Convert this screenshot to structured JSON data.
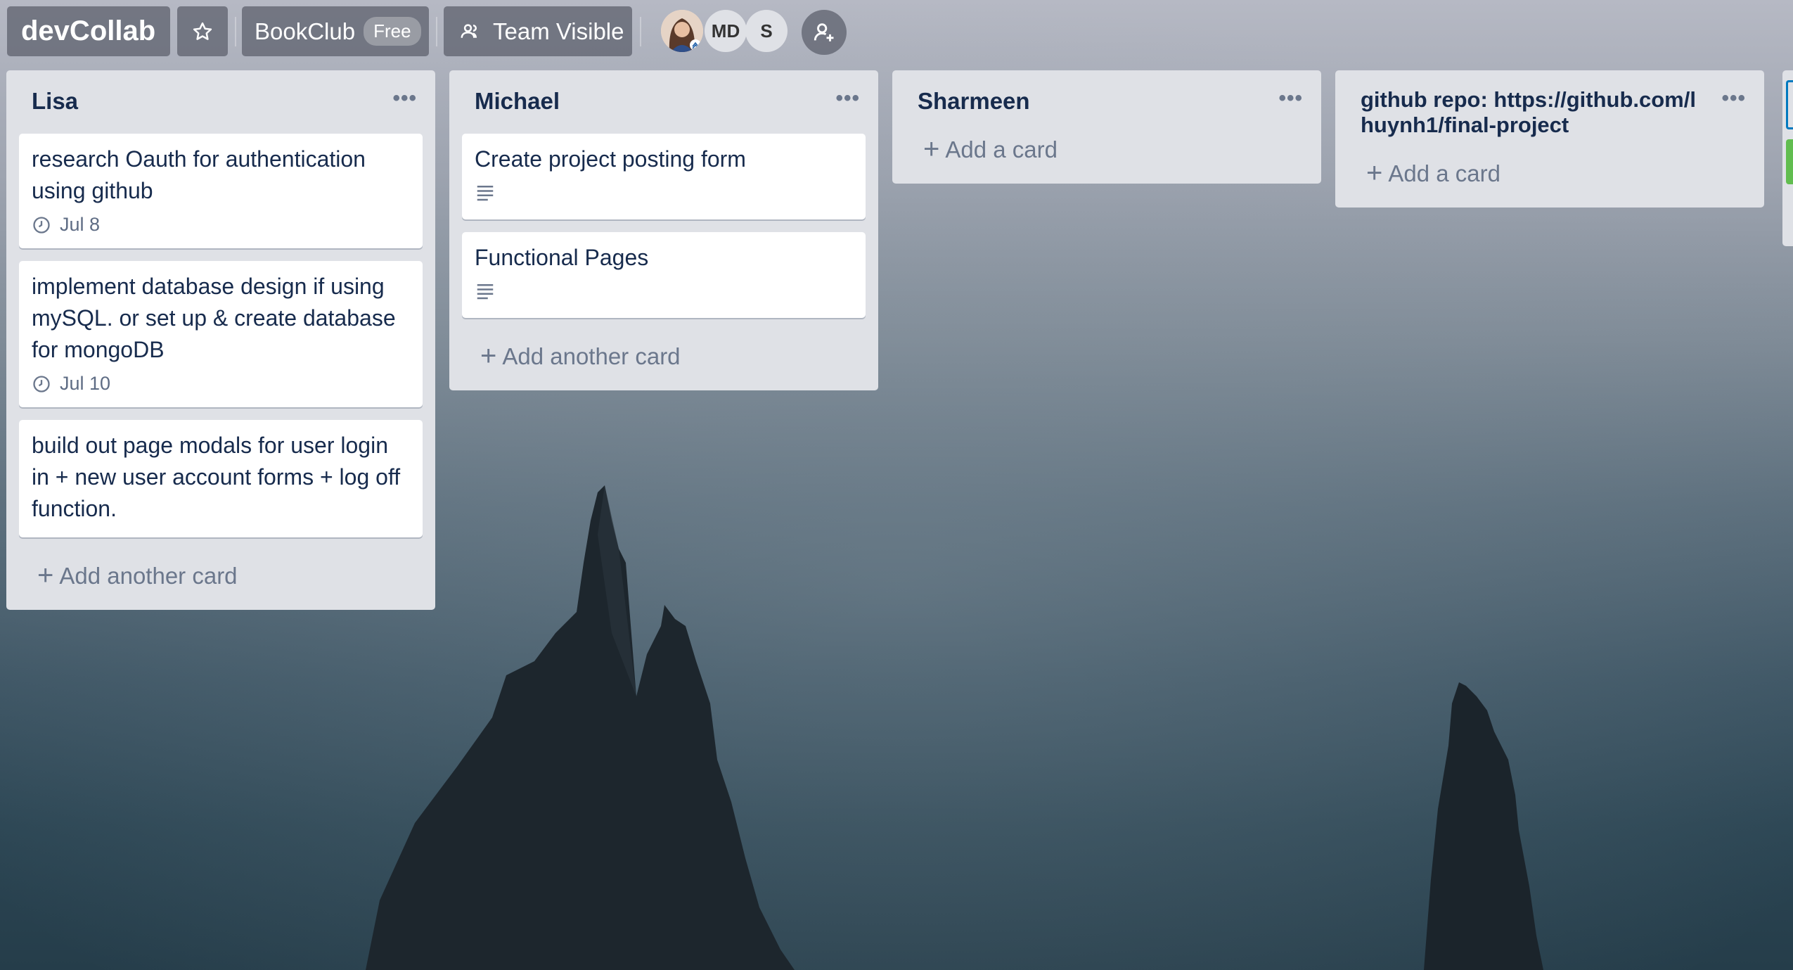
{
  "board": {
    "title": "devCollab",
    "org_name": "BookClub",
    "org_badge": "Free",
    "visibility": "Team Visible",
    "members": [
      {
        "initials": ""
      },
      {
        "initials": "MD"
      },
      {
        "initials": "S"
      }
    ]
  },
  "lists": [
    {
      "name": "Lisa",
      "cards": [
        {
          "title": "research Oauth for authentication using github",
          "due": "Jul 8"
        },
        {
          "title": "implement database design if using mySQL. or set up & create database for mongoDB",
          "due": "Jul 10"
        },
        {
          "title": "build out page modals for user login in + new user account forms + log off function."
        }
      ],
      "add_label": "Add another card"
    },
    {
      "name": "Michael",
      "cards": [
        {
          "title": "Create project posting form",
          "has_description": true
        },
        {
          "title": "Functional Pages",
          "has_description": true
        }
      ],
      "add_label": "Add another card"
    },
    {
      "name": "Sharmeen",
      "cards": [],
      "add_label": "Add a card"
    },
    {
      "name": "github repo: https://github.com/lhuynh1/final-project",
      "cards": [],
      "add_label": "Add a card"
    }
  ],
  "icons": {
    "star": "star-icon",
    "visibility": "team-icon",
    "invite": "add-member-icon",
    "due": "clock-icon",
    "description": "description-icon",
    "menu": "more-icon"
  },
  "colors": {
    "list_bg": "#dfe1e6",
    "card_bg": "#ffffff",
    "header_btn": "#646874",
    "text": "#172b4d",
    "muted": "#6b778c",
    "label_green": "#61bd4f",
    "label_blue": "#0079bf"
  }
}
